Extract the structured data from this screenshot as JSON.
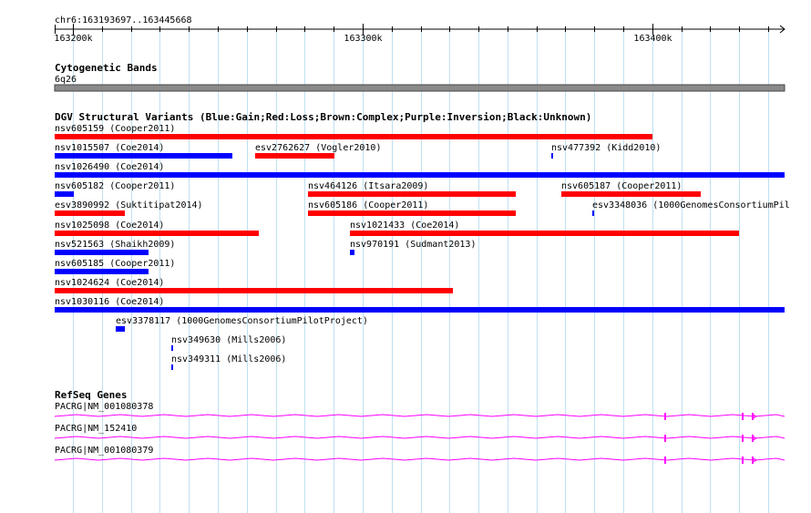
{
  "coordinate_range": "chr6:163193697..163445668",
  "ruler": {
    "start": 163193697,
    "end": 163445668,
    "ticks": [
      {
        "pos": 163200000,
        "label": "163200k"
      },
      {
        "pos": 163300000,
        "label": "163300k"
      },
      {
        "pos": 163400000,
        "label": "163400k"
      }
    ]
  },
  "tracks": {
    "cytoband": {
      "title": "Cytogenetic Bands",
      "band": "6q26"
    },
    "dgv": {
      "title": "DGV Structural Variants (Blue:Gain;Red:Loss;Brown:Complex;Purple:Inversion;Black:Unknown)"
    },
    "refseq": {
      "title": "RefSeq Genes"
    }
  },
  "variant_colors": {
    "gain": "#0000ff",
    "loss": "#ff0000"
  },
  "variants": [
    {
      "label": "nsv605159 (Cooper2011)",
      "type": "loss",
      "row": 0,
      "start": 163193697,
      "end": 163400000
    },
    {
      "label": "nsv1015507 (Coe2014)",
      "type": "gain",
      "row": 1,
      "start": 163193697,
      "end": 163255100
    },
    {
      "label": "esv2762627 (Vogler2010)",
      "type": "loss",
      "row": 1,
      "start": 163263000,
      "end": 163290500
    },
    {
      "label": "nsv477392 (Kidd2010)",
      "type": "gain",
      "row": 1,
      "start": 163365000,
      "end": 163365500
    },
    {
      "label": "nsv1026490 (Coe2014)",
      "type": "gain",
      "row": 2,
      "start": 163193697,
      "end": 163445668
    },
    {
      "label": "nsv605182 (Cooper2011)",
      "type": "gain",
      "row": 3,
      "start": 163193697,
      "end": 163200300
    },
    {
      "label": "nsv464126 (Itsara2009)",
      "type": "loss",
      "row": 3,
      "start": 163281100,
      "end": 163352800
    },
    {
      "label": "nsv605187 (Cooper2011)",
      "type": "loss",
      "row": 3,
      "start": 163368500,
      "end": 163416600
    },
    {
      "label": "esv3890992 (Suktitipat2014)",
      "type": "loss",
      "row": 4,
      "start": 163193697,
      "end": 163217800
    },
    {
      "label": "nsv605186 (Cooper2011)",
      "type": "loss",
      "row": 4,
      "start": 163281100,
      "end": 163352800
    },
    {
      "label": "esv3348036 (1000GenomesConsortiumPil",
      "type": "gain",
      "row": 4,
      "start": 163379400,
      "end": 163380000
    },
    {
      "label": "nsv1025098 (Coe2014)",
      "type": "loss",
      "row": 5,
      "start": 163193697,
      "end": 163264200
    },
    {
      "label": "nsv1021433 (Coe2014)",
      "type": "loss",
      "row": 5,
      "start": 163295700,
      "end": 163430000
    },
    {
      "label": "nsv521563 (Shaikh2009)",
      "type": "gain",
      "row": 6,
      "start": 163193697,
      "end": 163226000
    },
    {
      "label": "nsv970191 (Sudmant2013)",
      "type": "gain",
      "row": 6,
      "start": 163295700,
      "end": 163297300
    },
    {
      "label": "nsv605185 (Cooper2011)",
      "type": "gain",
      "row": 7,
      "start": 163193697,
      "end": 163226000
    },
    {
      "label": "nsv1024624 (Coe2014)",
      "type": "loss",
      "row": 8,
      "start": 163193697,
      "end": 163331100
    },
    {
      "label": "nsv1030116 (Coe2014)",
      "type": "gain",
      "row": 9,
      "start": 163193697,
      "end": 163445668
    },
    {
      "label": "esv3378117 (1000GenomesConsortiumPilotProject)",
      "type": "gain",
      "row": 10,
      "start": 163214700,
      "end": 163217800
    },
    {
      "label": "nsv349630 (Mills2006)",
      "type": "gain",
      "row": 11,
      "start": 163233900,
      "end": 163234500
    },
    {
      "label": "nsv349311 (Mills2006)",
      "type": "gain",
      "row": 12,
      "start": 163233900,
      "end": 163234500
    }
  ],
  "gene_color": "#ff00ff",
  "genes": [
    {
      "label": "PACRG|NM_001080378"
    },
    {
      "label": "PACRG|NM_152410"
    },
    {
      "label": "PACRG|NM_001080379"
    }
  ],
  "exon_positions": [
    163404000,
    163431000,
    163434500
  ]
}
